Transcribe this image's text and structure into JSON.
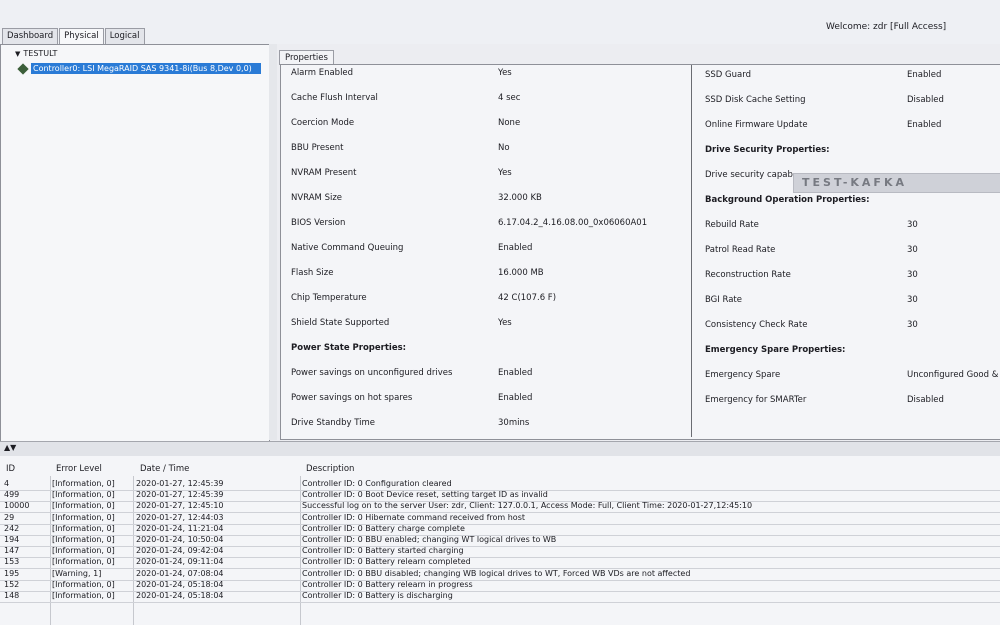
{
  "header": {
    "welcome": "Welcome: zdr [Full Access]"
  },
  "tabs": [
    {
      "label": "Dashboard"
    },
    {
      "label": "Physical"
    },
    {
      "label": "Logical"
    }
  ],
  "tree": {
    "root": "TESTULT",
    "selected": "Controller0: LSI MegaRAID SAS 9341-8i(Bus 8,Dev 0,0)"
  },
  "properties_tab": "Properties",
  "left_column": [
    {
      "label": "Alarm Enabled",
      "value": "Yes"
    },
    {
      "label": "Cache Flush Interval",
      "value": "4 sec"
    },
    {
      "label": "Coercion Mode",
      "value": "None"
    },
    {
      "label": "BBU Present",
      "value": "No"
    },
    {
      "label": "NVRAM Present",
      "value": "Yes"
    },
    {
      "label": "NVRAM Size",
      "value": "32.000 KB"
    },
    {
      "label": "BIOS Version",
      "value": "6.17.04.2_4.16.08.00_0x06060A01"
    },
    {
      "label": "Native Command Queuing",
      "value": "Enabled"
    },
    {
      "label": "Flash Size",
      "value": "16.000 MB"
    },
    {
      "label": "Chip Temperature",
      "value": "42 C(107.6 F)"
    },
    {
      "label": "Shield State Supported",
      "value": "Yes"
    },
    {
      "label": "Power State Properties:",
      "value": "",
      "header": true
    },
    {
      "label": "Power savings on unconfigured drives",
      "value": "Enabled"
    },
    {
      "label": "Power savings on hot spares",
      "value": "Enabled"
    },
    {
      "label": "Drive Standby Time",
      "value": "30mins"
    }
  ],
  "right_column": [
    {
      "label": "SSD Guard",
      "value": "Enabled"
    },
    {
      "label": "SSD Disk Cache Setting",
      "value": "Disabled"
    },
    {
      "label": "Online Firmware Update",
      "value": "Enabled"
    },
    {
      "label": "Drive Security Properties:",
      "value": "",
      "header": true
    },
    {
      "label": "Drive security capab",
      "value": ""
    },
    {
      "label": "Background Operation Properties:",
      "value": "",
      "header": true
    },
    {
      "label": "Rebuild Rate",
      "value": "30"
    },
    {
      "label": "Patrol Read Rate",
      "value": "30"
    },
    {
      "label": "Reconstruction Rate",
      "value": "30"
    },
    {
      "label": "BGI Rate",
      "value": "30"
    },
    {
      "label": "Consistency Check Rate",
      "value": "30"
    },
    {
      "label": "Emergency Spare Properties:",
      "value": "",
      "header": true
    },
    {
      "label": "Emergency Spare",
      "value": "Unconfigured Good &"
    },
    {
      "label": "Emergency for SMARTer",
      "value": "Disabled"
    }
  ],
  "watermark": "TEST-KAFKA",
  "log": {
    "headers": [
      "ID",
      "Error Level",
      "Date / Time",
      "Description"
    ],
    "rows": [
      [
        "4",
        "[Information, 0]",
        "2020-01-27, 12:45:39",
        "Controller ID: 0 Configuration cleared"
      ],
      [
        "499",
        "[Information, 0]",
        "2020-01-27, 12:45:39",
        "Controller ID: 0 Boot Device reset, setting target ID as invalid"
      ],
      [
        "10000",
        "[Information, 0]",
        "2020-01-27, 12:45:10",
        "Successful log on to the server User:  zdr, Client:  127.0.0.1,   Access Mode:  Full, Client Time:  2020-01-27,12:45:10"
      ],
      [
        "29",
        "[Information, 0]",
        "2020-01-27, 12:44:03",
        "Controller ID:  0   Hibernate command received from host"
      ],
      [
        "242",
        "[Information, 0]",
        "2020-01-24, 11:21:04",
        "Controller ID:  0   Battery charge complete"
      ],
      [
        "194",
        "[Information, 0]",
        "2020-01-24, 10:50:04",
        "Controller ID:  0   BBU enabled; changing WT logical drives to WB"
      ],
      [
        "147",
        "[Information, 0]",
        "2020-01-24, 09:42:04",
        "Controller ID:  0   Battery started charging"
      ],
      [
        "153",
        "[Information, 0]",
        "2020-01-24, 09:11:04",
        "Controller ID:  0   Battery relearn completed"
      ],
      [
        "195",
        "[Warning, 1]",
        "2020-01-24, 07:08:04",
        "Controller ID:  0   BBU disabled; changing WB logical drives to WT, Forced WB VDs are not affected"
      ],
      [
        "152",
        "[Information, 0]",
        "2020-01-24, 05:18:04",
        "Controller ID:  0   Battery relearn in progress"
      ],
      [
        "148",
        "[Information, 0]",
        "2020-01-24, 05:18:04",
        "Controller ID:  0   Battery is discharging"
      ]
    ]
  }
}
